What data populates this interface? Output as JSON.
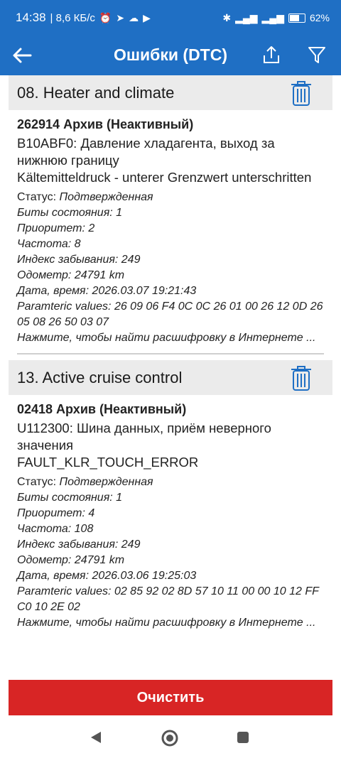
{
  "status_bar": {
    "time": "14:38",
    "speed": "| 8,6 КБ/с",
    "icons": [
      "alarm-icon",
      "telegram-icon",
      "cloud-icon",
      "youtube-icon"
    ],
    "right_icons": [
      "bluetooth-icon",
      "signal-icon",
      "wifi-icon",
      "battery-icon"
    ],
    "battery": "62%"
  },
  "appbar": {
    "title": "Ошибки (DTC)"
  },
  "sections": [
    {
      "title": "08. Heater and climate",
      "code_line": "262914 Архив (Неактивный)",
      "desc": "B10ABF0: Давление хладагента, выход за нижнюю границу",
      "desc2": "Kältemitteldruck - unterer Grenzwert unterschritten",
      "status_label": "Статус:",
      "status_value": "Подтвержденная",
      "bits": "Биты состояния: 1",
      "priority": "Приоритет: 2",
      "freq": "Частота: 8",
      "forget": "Индекс забывания: 249",
      "odometer": "Одометр: 24791 km",
      "datetime": "Дата, время: 2026.03.07 19:21:43",
      "params": "Paramteric values:  26 09 06 F4 0C 0C 26 01 00 26 12 0D 26 05 08 26 50 03 07",
      "search": "Нажмите, чтобы найти расшифровку в Интернете ..."
    },
    {
      "title": "13. Active cruise control",
      "code_line": "02418 Архив (Неактивный)",
      "desc": "U112300: Шина данных, приём неверного значения",
      "desc2": "FAULT_KLR_TOUCH_ERROR",
      "status_label": "Статус:",
      "status_value": "Подтвержденная",
      "bits": "Биты состояния: 1",
      "priority": "Приоритет: 4",
      "freq": "Частота: 108",
      "forget": "Индекс забывания: 249",
      "odometer": "Одометр: 24791 km",
      "datetime": "Дата, время: 2026.03.06 19:25:03",
      "params": "Paramteric values:  02 85 92 02 8D 57 10 11 00 00 10 12 FF C0 10 2E 02",
      "search": "Нажмите, чтобы найти расшифровку в Интернете ..."
    }
  ],
  "clear_button": "Очистить",
  "colors": {
    "primary": "#1f6fc4",
    "danger": "#d82525",
    "section_bg": "#ebebeb"
  }
}
